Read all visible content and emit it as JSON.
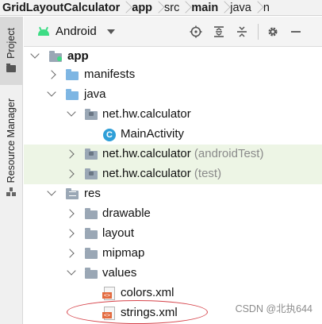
{
  "breadcrumb": [
    {
      "label": "GridLayoutCalculator",
      "bold": true
    },
    {
      "label": "app",
      "bold": true
    },
    {
      "label": "src",
      "bold": false
    },
    {
      "label": "main",
      "bold": true
    },
    {
      "label": "java",
      "bold": false
    },
    {
      "label": "n",
      "bold": false
    }
  ],
  "tool_strip": {
    "project_tab": "Project",
    "resource_manager_tab": "Resource Manager"
  },
  "toolbar": {
    "view_selector": "Android",
    "icons": [
      "locate-icon",
      "expand-all-icon",
      "collapse-all-icon",
      "settings-icon",
      "hide-icon"
    ]
  },
  "tree": {
    "app": "app",
    "manifests": "manifests",
    "java": "java",
    "pkg_main": "net.hw.calculator",
    "main_activity": "MainActivity",
    "pkg_android_test": "net.hw.calculator",
    "android_test_suffix": "(androidTest)",
    "pkg_test": "net.hw.calculator",
    "test_suffix": "(test)",
    "res": "res",
    "drawable": "drawable",
    "layout": "layout",
    "mipmap": "mipmap",
    "values": "values",
    "colors_xml": "colors.xml",
    "strings_xml": "strings.xml"
  },
  "icon_glyphs": {
    "class_letter": "C",
    "xml_tag": "<>"
  },
  "watermark": "CSDN @北执644",
  "colors": {
    "highlight_row": "#edf5e5",
    "annotation_oval": "#d6434a",
    "android_green": "#3ddc84"
  }
}
